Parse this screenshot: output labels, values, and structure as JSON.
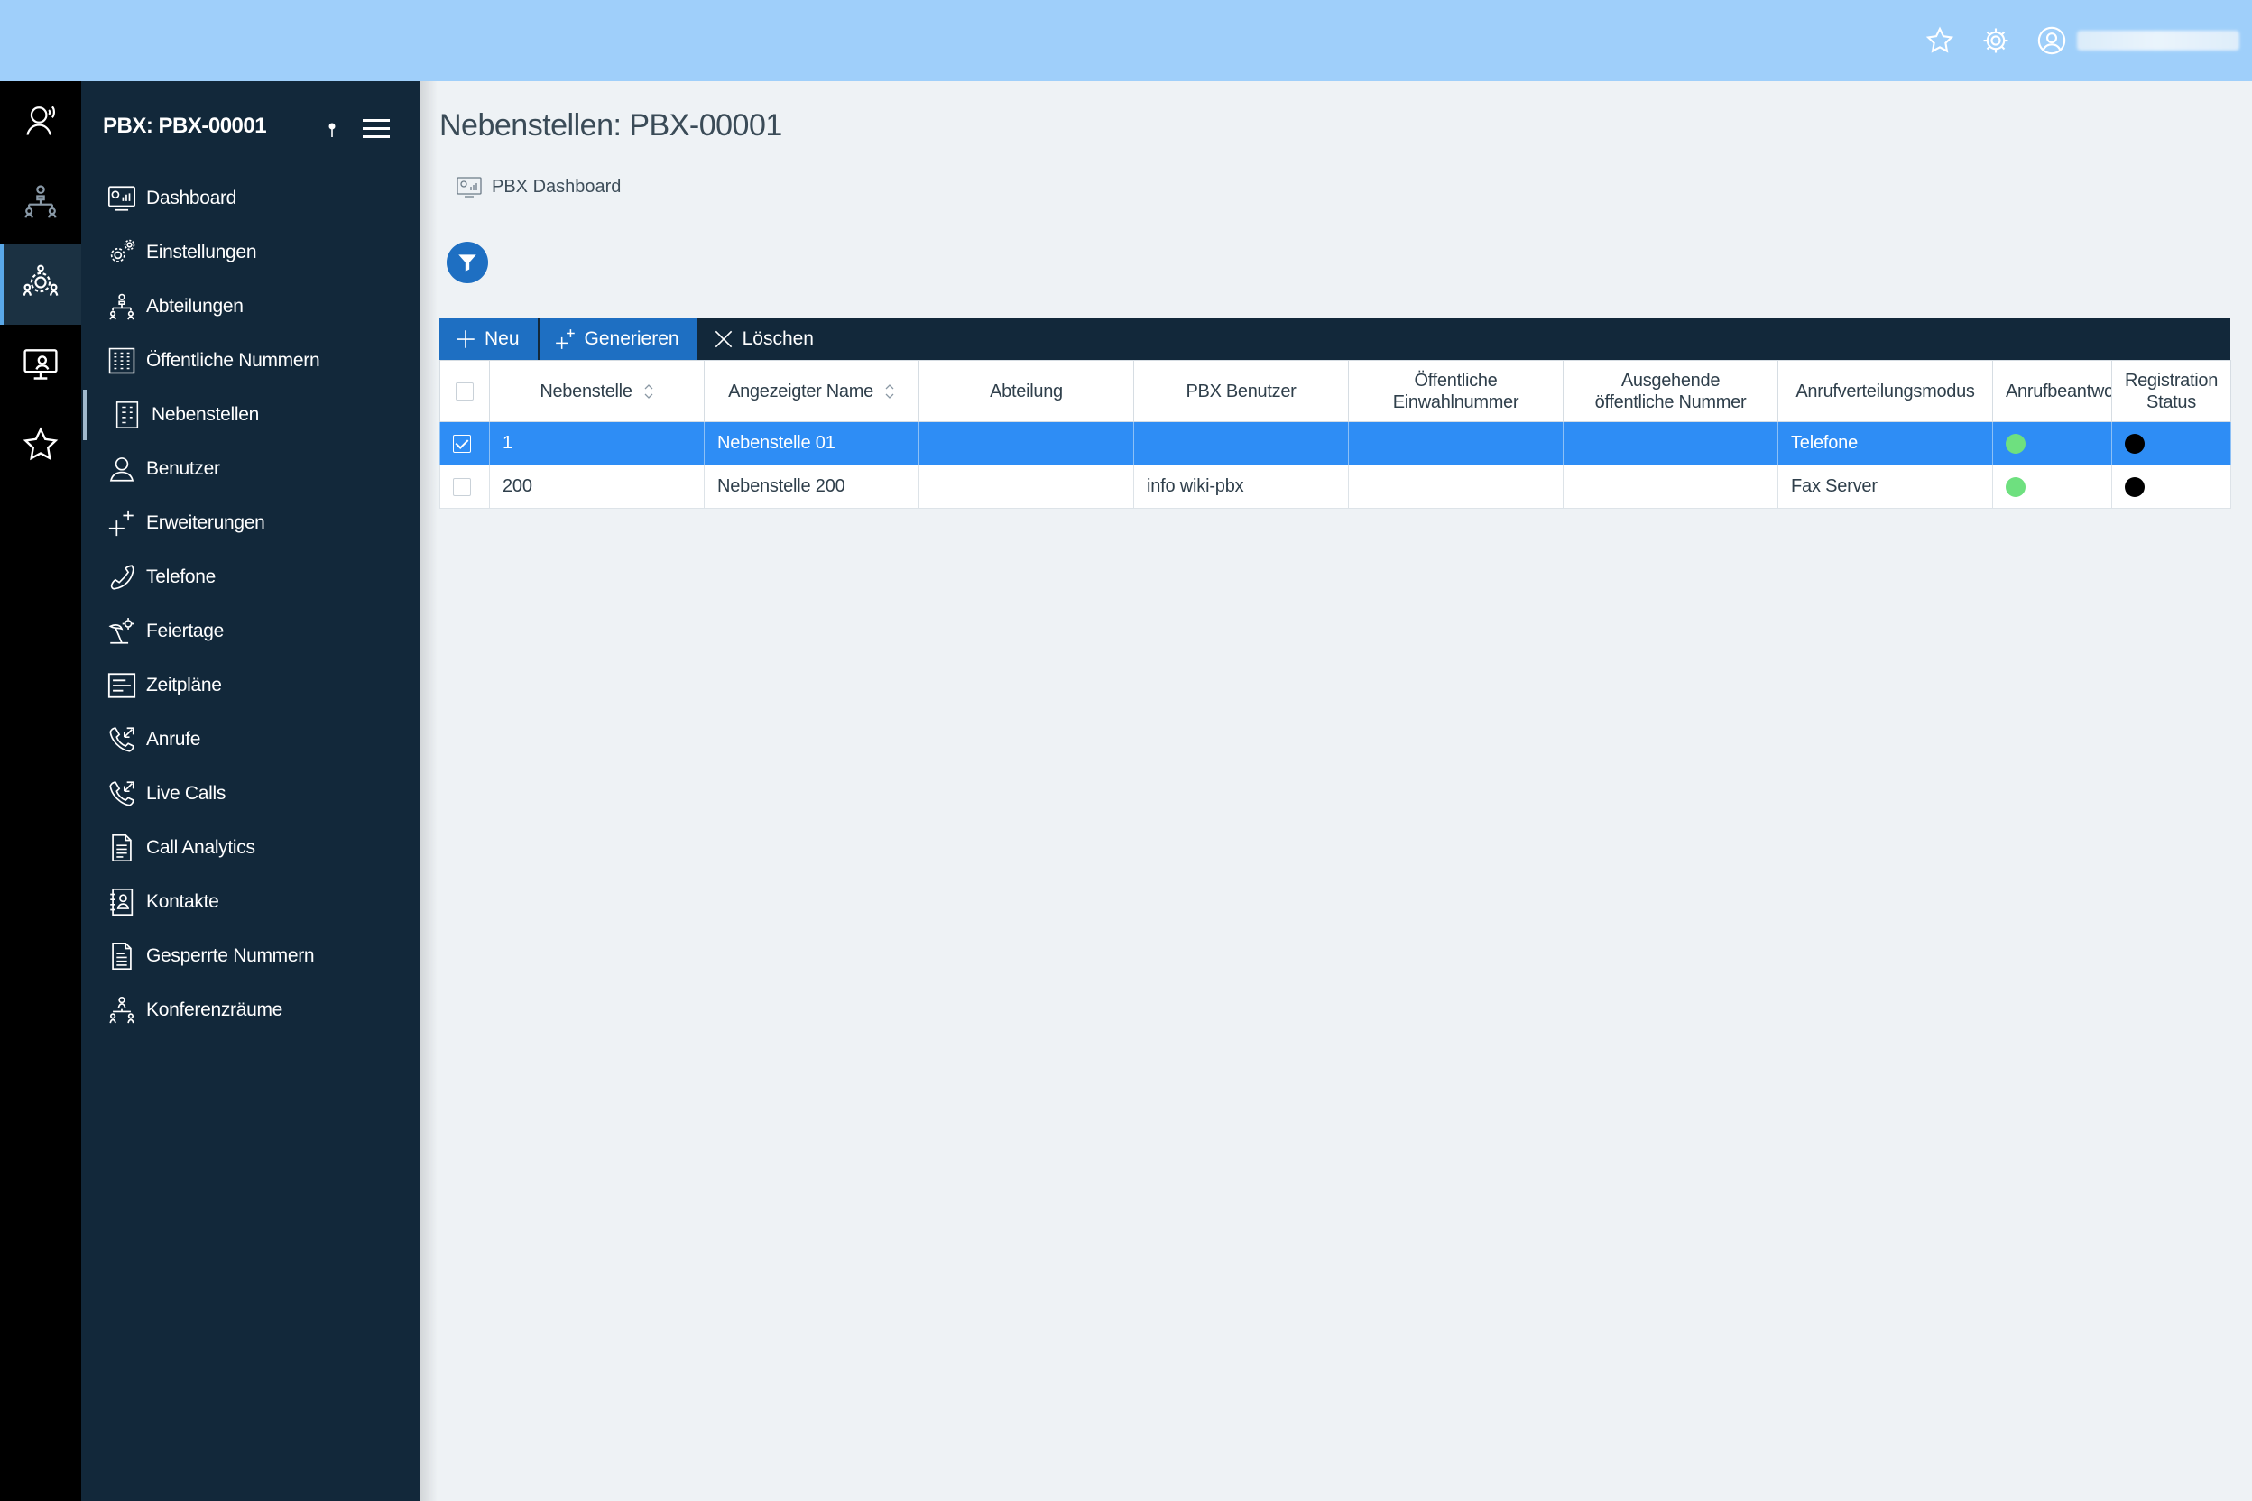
{
  "topbar": {
    "icons": [
      "star-icon",
      "gear-icon",
      "user-icon"
    ]
  },
  "rail": {
    "items": [
      {
        "icon": "headset-user-icon"
      },
      {
        "icon": "org-chart-icon"
      },
      {
        "icon": "team-settings-icon",
        "active": true
      },
      {
        "icon": "monitor-user-icon"
      },
      {
        "icon": "star-icon"
      }
    ]
  },
  "sidebar": {
    "title": "PBX: PBX-00001",
    "items": [
      {
        "label": "Dashboard",
        "icon": "dashboard-icon"
      },
      {
        "label": "Einstellungen",
        "icon": "gears-icon"
      },
      {
        "label": "Abteilungen",
        "icon": "org-chart-icon"
      },
      {
        "label": "Öffentliche Nummern",
        "icon": "numbers-grid-icon"
      },
      {
        "label": "Nebenstellen",
        "icon": "extension-icon",
        "active": true
      },
      {
        "label": "Benutzer",
        "icon": "user-icon"
      },
      {
        "label": "Erweiterungen",
        "icon": "plus-sparkle-icon"
      },
      {
        "label": "Telefone",
        "icon": "phone-icon"
      },
      {
        "label": "Feiertage",
        "icon": "beach-icon"
      },
      {
        "label": "Zeitpläne",
        "icon": "schedule-icon"
      },
      {
        "label": "Anrufe",
        "icon": "call-arrows-icon"
      },
      {
        "label": "Live Calls",
        "icon": "call-arrows-icon"
      },
      {
        "label": "Call Analytics",
        "icon": "report-icon"
      },
      {
        "label": "Kontakte",
        "icon": "contact-book-icon"
      },
      {
        "label": "Gesperrte Nummern",
        "icon": "blocked-doc-icon"
      },
      {
        "label": "Konferenzräume",
        "icon": "conference-icon"
      }
    ]
  },
  "main": {
    "title": "Nebenstellen: PBX-00001",
    "breadcrumb": "PBX Dashboard",
    "toolbar": {
      "new_label": "Neu",
      "generate_label": "Generieren",
      "delete_label": "Löschen"
    },
    "table": {
      "headers": {
        "extension": "Nebenstelle",
        "display_name": "Angezeigter Name",
        "department": "Abteilung",
        "pbx_user": "PBX Benutzer",
        "public_dialin": "Öffentliche Einwahlnummer",
        "outgoing_public": "Ausgehende öffentliche Nummer",
        "distribution_mode": "Anrufverteilungsmodus",
        "voicemail": "Anrufbeantworter",
        "registration": "Registration Status"
      },
      "rows": [
        {
          "selected": true,
          "extension": "1",
          "display_name": "Nebenstelle 01",
          "department": "",
          "pbx_user": "",
          "public_dialin": "",
          "outgoing_public": "",
          "distribution_mode": "Telefone",
          "voicemail_color": "#6ee07f",
          "registration_color": "#000000"
        },
        {
          "selected": false,
          "extension": "200",
          "display_name": "Nebenstelle 200",
          "department": "",
          "pbx_user": "info wiki-pbx",
          "public_dialin": "",
          "outgoing_public": "",
          "distribution_mode": "Fax Server",
          "voicemail_color": "#6ee07f",
          "registration_color": "#000000"
        }
      ]
    }
  },
  "colors": {
    "topbar": "#9fcffa",
    "sidebar": "#12283a",
    "accent": "#1e6fc2",
    "selected_row": "#2e8df5"
  }
}
